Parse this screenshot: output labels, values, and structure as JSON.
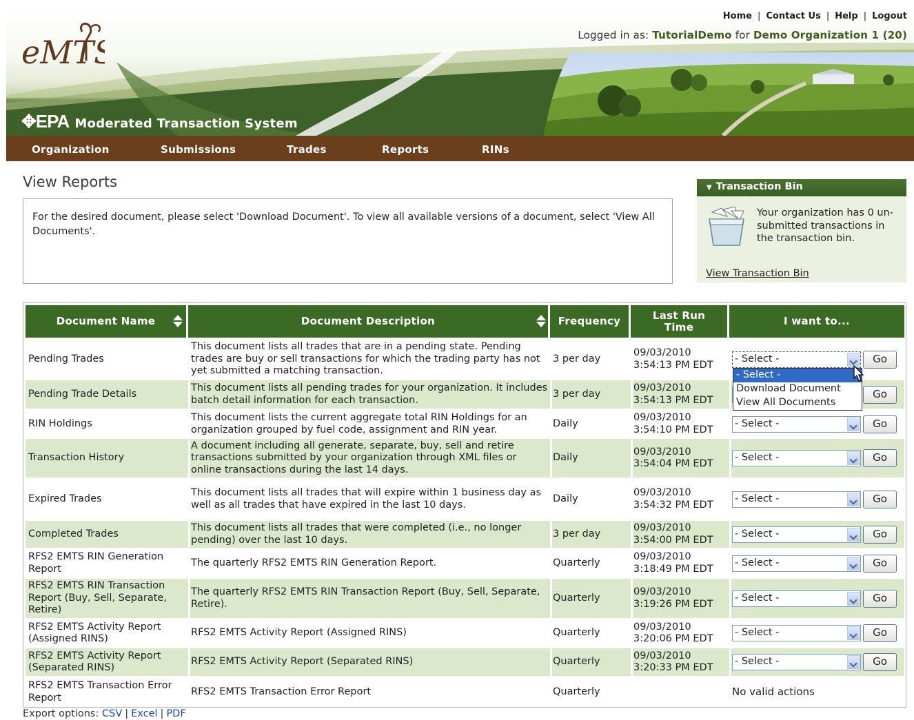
{
  "header": {
    "links": [
      "Home",
      "Contact Us",
      "Help",
      "Logout"
    ],
    "login_prefix": "Logged in as:",
    "login_user": "TutorialDemo",
    "login_for": "for",
    "login_org": "Demo Organization 1 (20)",
    "logo_text": "eMTS",
    "epa_mark": "EPA",
    "system_name": "Moderated Transaction System"
  },
  "nav": [
    "Organization",
    "Submissions",
    "Trades",
    "Reports",
    "RINs"
  ],
  "page": {
    "title": "View Reports",
    "info": "For the desired document, please select 'Download Document'. To view all available versions of a document, select 'View All Documents'."
  },
  "transaction_bin": {
    "title": "Transaction Bin",
    "text": "Your organization has 0 un-submitted transactions in the transaction bin.",
    "link": "View Transaction Bin"
  },
  "table": {
    "headers": {
      "name": "Document Name",
      "description": "Document Description",
      "frequency": "Frequency",
      "last_run": "Last Run Time",
      "action": "I want to..."
    },
    "select_default": "- Select -",
    "go_label": "Go",
    "rows": [
      {
        "name": "Pending Trades",
        "description": "This document lists all trades that are in a pending state. Pending trades are buy or sell transactions for which the trading party has not yet submitted a matching transaction.",
        "frequency": "3 per day",
        "date": "09/03/2010",
        "time": "3:54:13 PM EDT"
      },
      {
        "name": "Pending Trade Details",
        "description": "This document lists all pending trades for your organization. It includes batch detail information for each transaction.",
        "frequency": "3 per day",
        "date": "09/03/2010",
        "time": "3:54:13 PM EDT"
      },
      {
        "name": "RIN Holdings",
        "description": "This document lists the current aggregate total RIN Holdings for an organization grouped by fuel code, assignment and RIN year.",
        "frequency": "Daily",
        "date": "09/03/2010",
        "time": "3:54:10 PM EDT"
      },
      {
        "name": "Transaction History",
        "description": "A document including all generate, separate, buy, sell and retire transactions submitted by your organization through XML files or online transactions during the last 14 days.",
        "frequency": "Daily",
        "date": "09/03/2010",
        "time": "3:54:04 PM EDT"
      },
      {
        "name": "Expired Trades",
        "description": "This document lists all trades that will expire within 1 business day as well as all trades that have expired in the last 10 days.",
        "frequency": "Daily",
        "date": "09/03/2010",
        "time": "3:54:32 PM EDT"
      },
      {
        "name": "Completed Trades",
        "description": "This document lists all trades that were completed (i.e., no longer pending) over the last 10 days.",
        "frequency": "3 per day",
        "date": "09/03/2010",
        "time": "3:54:00 PM EDT"
      },
      {
        "name": "RFS2 EMTS RIN Generation Report",
        "description": "The quarterly RFS2 EMTS RIN Generation Report.",
        "frequency": "Quarterly",
        "date": "09/03/2010",
        "time": "3:18:49 PM EDT"
      },
      {
        "name": "RFS2 EMTS RIN Transaction Report (Buy, Sell, Separate, Retire)",
        "description": "The quarterly RFS2 EMTS RIN Transaction Report (Buy, Sell, Separate, Retire).",
        "frequency": "Quarterly",
        "date": "09/03/2010",
        "time": "3:19:26 PM EDT"
      },
      {
        "name": "RFS2 EMTS Activity Report (Assigned RINS)",
        "description": "RFS2 EMTS Activity Report (Assigned RINS)",
        "frequency": "Quarterly",
        "date": "09/03/2010",
        "time": "3:20:06 PM EDT"
      },
      {
        "name": "RFS2 EMTS Activity Report (Separated RINS)",
        "description": "RFS2 EMTS Activity Report (Separated RINS)",
        "frequency": "Quarterly",
        "date": "09/03/2010",
        "time": "3:20:33 PM EDT"
      },
      {
        "name": "RFS2 EMTS Transaction Error Report",
        "description": "RFS2 EMTS Transaction Error Report",
        "frequency": "Quarterly",
        "date": "",
        "time": "",
        "action_text": "No valid actions"
      }
    ],
    "dropdown_open": {
      "options": [
        "- Select -",
        "Download Document",
        "View All Documents"
      ],
      "highlighted": "- Select -"
    }
  },
  "export": {
    "label": "Export options:",
    "options": [
      "CSV",
      "Excel",
      "PDF"
    ]
  },
  "colors": {
    "header_green": "#3a6a23",
    "nav_brown": "#6b3e1c",
    "row_alt": "#dbe8cc",
    "bin_bg": "#eaf1e0",
    "link_blue": "#1f3fbf"
  }
}
